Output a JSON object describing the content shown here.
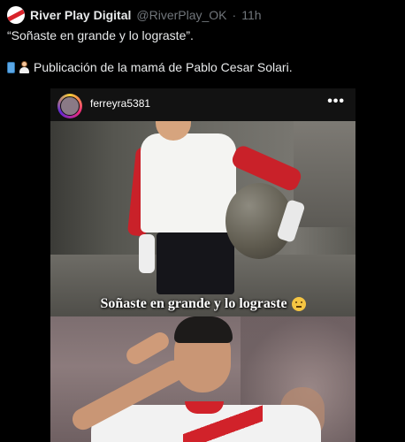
{
  "tweet": {
    "author_name": "River Play Digital",
    "handle": "@RiverPlay_OK",
    "separator": "·",
    "time": "11h",
    "text_line1": "“Soñaste en grande y lo lograste”.",
    "text_line2": "Publicación de la mamá de Pablo Cesar Solari.",
    "line2_icons": [
      "mobile-phone-icon",
      "woman-with-veil-icon"
    ]
  },
  "embed": {
    "username": "ferreyra5381",
    "more_icon": "more-horizontal-icon",
    "more_glyph": "•••",
    "caption": "Soñaste en grande y lo lograste",
    "caption_emoji": "saluting-face-icon"
  },
  "colors": {
    "background": "#000000",
    "text": "#e7e9ea",
    "muted": "#71767b",
    "river_red": "#d1222a"
  }
}
